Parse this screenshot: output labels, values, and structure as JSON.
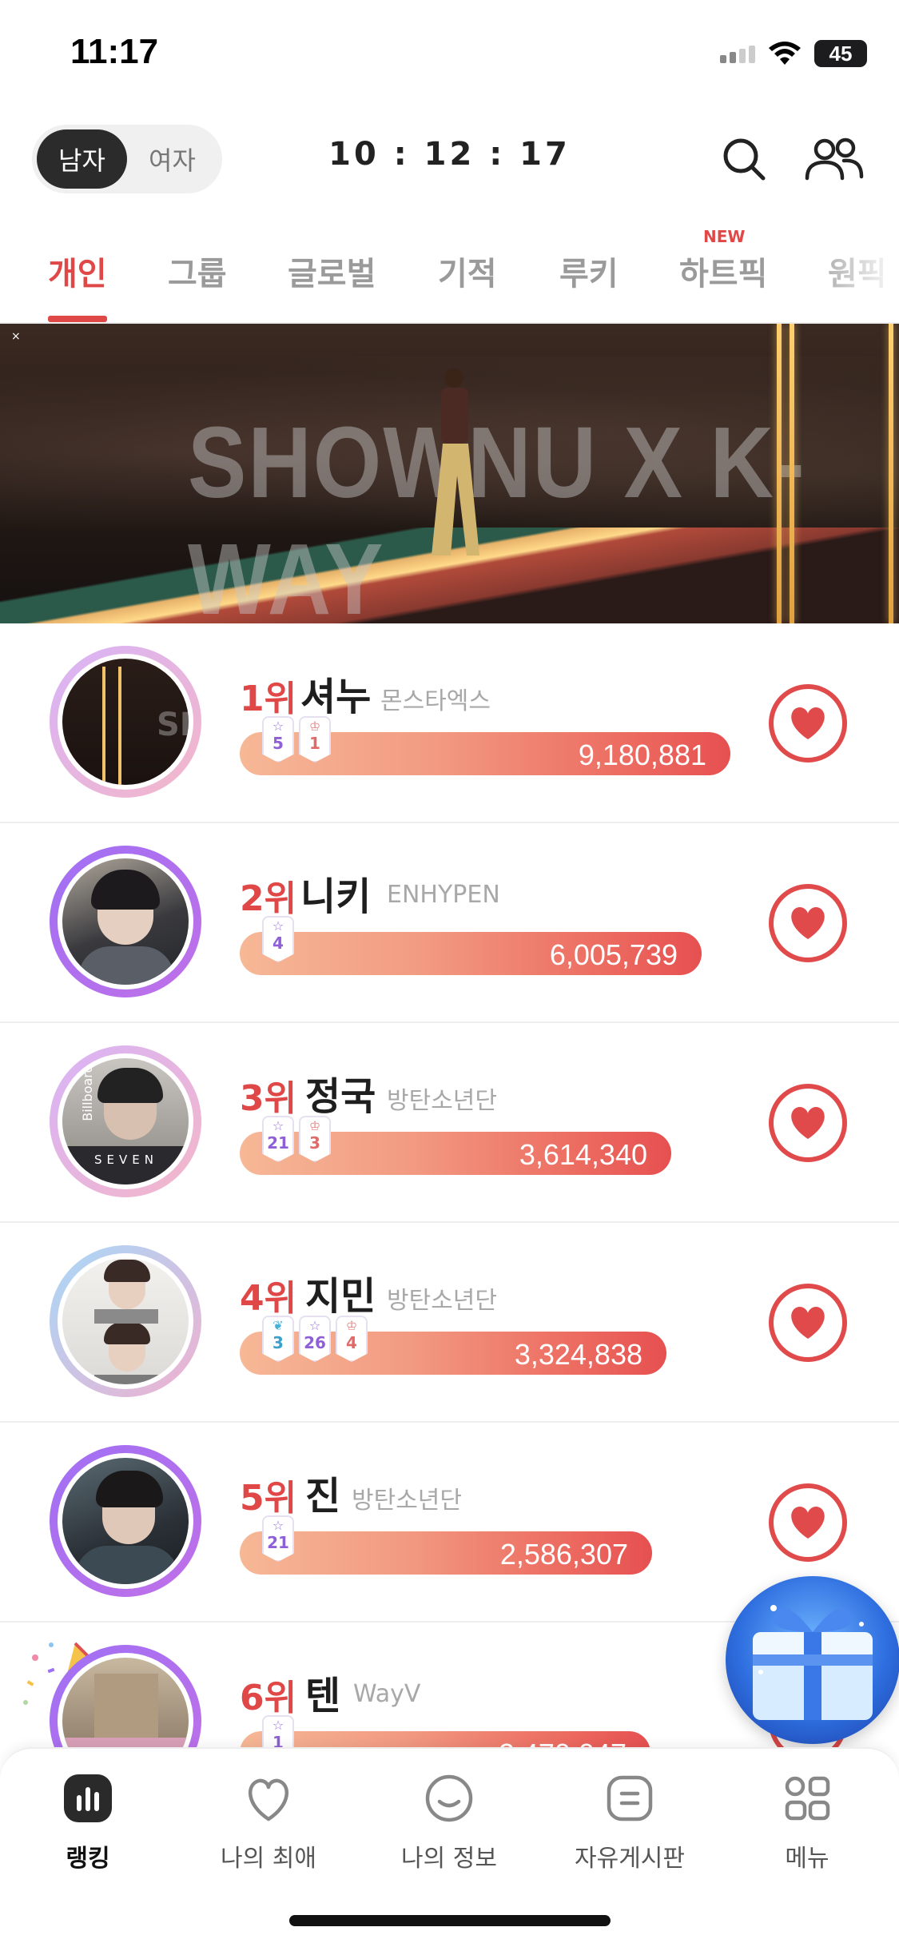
{
  "status_bar": {
    "time": "11:17",
    "battery": "45"
  },
  "header": {
    "gender": {
      "male": "남자",
      "female": "여자",
      "selected": "male"
    },
    "timer": "10 : 12 : 17"
  },
  "tabs": [
    {
      "label": "개인",
      "active": true
    },
    {
      "label": "그룹"
    },
    {
      "label": "글로벌"
    },
    {
      "label": "기적"
    },
    {
      "label": "루키"
    },
    {
      "label": "하트픽",
      "badge": "NEW"
    },
    {
      "label": "원픽"
    }
  ],
  "banner": {
    "title": "SHOWNU X K-WAY"
  },
  "rankings": [
    {
      "rank": "1위",
      "name": "셔누",
      "group": "몬스타엑스",
      "votes": "9,180,881",
      "bar_fraction": 1.0,
      "badges": [
        {
          "icon": "star-icon",
          "num": "5"
        },
        {
          "icon": "crown-icon",
          "num": "1"
        }
      ]
    },
    {
      "rank": "2위",
      "name": "니키",
      "group": "ENHYPEN",
      "votes": "6,005,739",
      "bar_fraction": 0.94,
      "badges": [
        {
          "icon": "star-icon",
          "num": "4"
        }
      ]
    },
    {
      "rank": "3위",
      "name": "정국",
      "group": "방탄소년단",
      "votes": "3,614,340",
      "bar_fraction": 0.88,
      "badges": [
        {
          "icon": "star-icon",
          "num": "21"
        },
        {
          "icon": "crown-icon",
          "num": "3"
        }
      ]
    },
    {
      "rank": "4위",
      "name": "지민",
      "group": "방탄소년단",
      "votes": "3,324,838",
      "bar_fraction": 0.87,
      "badges": [
        {
          "icon": "wing-icon",
          "num": "3"
        },
        {
          "icon": "star-icon",
          "num": "26"
        },
        {
          "icon": "crown-icon",
          "num": "4"
        }
      ]
    },
    {
      "rank": "5위",
      "name": "진",
      "group": "방탄소년단",
      "votes": "2,586,307",
      "bar_fraction": 0.84,
      "badges": [
        {
          "icon": "star-icon",
          "num": "21"
        }
      ]
    },
    {
      "rank": "6위",
      "name": "텐",
      "group": "WayV",
      "votes": "2,470,047",
      "bar_fraction": 0.83,
      "badges": [
        {
          "icon": "star-icon",
          "num": "1"
        }
      ]
    }
  ],
  "bottom_nav": [
    {
      "label": "랭킹",
      "icon": "ranking-icon",
      "active": true
    },
    {
      "label": "나의 최애",
      "icon": "heart-outline-icon"
    },
    {
      "label": "나의 정보",
      "icon": "smile-icon"
    },
    {
      "label": "자유게시판",
      "icon": "board-icon"
    },
    {
      "label": "메뉴",
      "icon": "menu-grid-icon"
    }
  ],
  "colors": {
    "accent": "#e04848",
    "bar_start": "#f6b896",
    "bar_end": "#e65050"
  }
}
